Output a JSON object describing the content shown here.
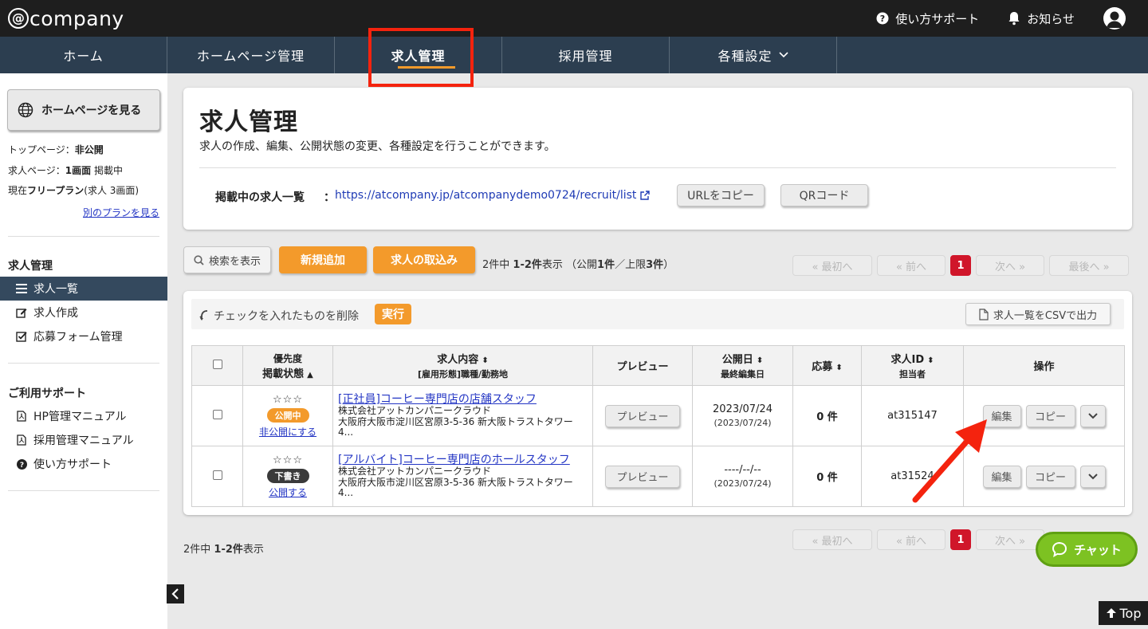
{
  "brand": {
    "at": "@",
    "name": "company"
  },
  "topbar": {
    "support": "使い方サポート",
    "notifications": "お知らせ"
  },
  "nav": {
    "items": [
      {
        "label": "ホーム"
      },
      {
        "label": "ホームページ管理"
      },
      {
        "label": "求人管理",
        "active": true
      },
      {
        "label": "採用管理"
      },
      {
        "label": "各種設定"
      }
    ]
  },
  "sidebar": {
    "view_hp": "ホームページを見る",
    "top_page_label": "トップページ：",
    "top_page_value": "非公開",
    "job_page_label": "求人ページ：",
    "job_page_count": "1画面",
    "job_page_status": " 掲載中",
    "plan_prefix": "現在",
    "plan_name": "フリープラン",
    "plan_suffix": "(求人 3画面)",
    "other_plan": "別のプランを見る",
    "section1": "求人管理",
    "items1": [
      "求人一覧",
      "求人作成",
      "応募フォーム管理"
    ],
    "section2": "ご利用サポート",
    "items2": [
      "HP管理マニュアル",
      "採用管理マニュアル",
      "使い方サポート"
    ]
  },
  "header": {
    "title": "求人管理",
    "description": "求人の作成、編集、公開状態の変更、各種設定を行うことができます。",
    "url_label": "掲載中の求人一覧",
    "url_colon": "：",
    "url": "https://atcompany.jp/atcompanydemo0724/recruit/list",
    "copy_url": "URLをコピー",
    "qr": "QRコード"
  },
  "toolbar": {
    "search": "検索を表示",
    "add_new": "新規追加",
    "import": "求人の取込み",
    "count_pre": "2件中 ",
    "count_range": "1-2件",
    "count_mid": "表示 （公開",
    "count_pub": "1件",
    "count_mid2": "／上限",
    "count_limit": "3件",
    "count_end": "）"
  },
  "pager": {
    "first": "« 最初へ",
    "prev": "« 前へ",
    "current": "1",
    "next": "次へ »",
    "last": "最後へ »"
  },
  "bulk": {
    "text": "チェックを入れたものを削除",
    "exec": "実行",
    "csv": "求人一覧をCSVで出力"
  },
  "table": {
    "headers": {
      "priority": "優先度",
      "status": "掲載状態",
      "content": "求人内容",
      "content_sub": "[雇用形態]職種/勤務地",
      "preview": "プレビュー",
      "date": "公開日",
      "date_sub": "最終編集日",
      "apps": "応募",
      "id": "求人ID",
      "id_sub": "担当者",
      "ops": "操作"
    },
    "rows": [
      {
        "stars": "☆☆☆",
        "badge": "公開中",
        "status_link": "非公開にする",
        "title": "[正社員]コーヒー専門店の店舗スタッフ",
        "company": "株式会社アットカンパニークラウド",
        "address": "大阪府大阪市淀川区宮原3-5-36 新大阪トラストタワー4...",
        "preview": "プレビュー",
        "date": "2023/07/24",
        "edited": "(2023/07/24)",
        "apps": "0 件",
        "id": "at315147",
        "edit": "編集",
        "copy": "コピー"
      },
      {
        "stars": "☆☆☆",
        "badge": "下書き",
        "status_link": "公開する",
        "title": "[アルバイト]コーヒー専門店のホールスタッフ",
        "company": "株式会社アットカンパニークラウド",
        "address": "大阪府大阪市淀川区宮原3-5-36 新大阪トラストタワー4...",
        "preview": "プレビュー",
        "date": "----/--/--",
        "edited": "(2023/07/24)",
        "apps": "0 件",
        "id": "at31524",
        "edit": "編集",
        "copy": "コピー"
      }
    ]
  },
  "footer": {
    "count_pre": "2件中 ",
    "count_range": "1-2件",
    "count_end": "表示",
    "chat": "チャット",
    "top": "Top"
  },
  "colors": {
    "accent": "#f39a2b",
    "nav": "#2c3e50",
    "highlight": "#f4230e",
    "chat": "#7dc222"
  }
}
